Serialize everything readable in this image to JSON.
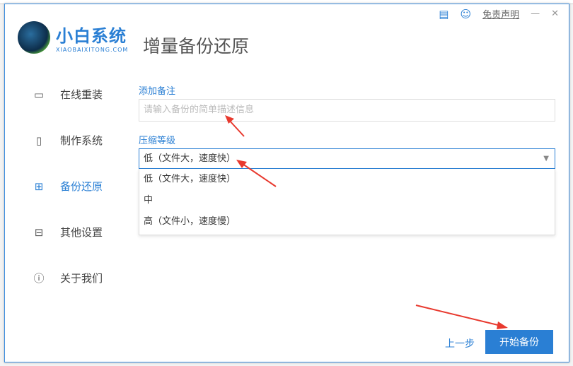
{
  "header": {
    "logo_title": "小白系统",
    "logo_sub": "XIAOBAIXITONG.COM",
    "page_title": "增量备份还原",
    "disclaimer": "免责声明",
    "minimize": "—",
    "close": "✕"
  },
  "nav": [
    {
      "label": "在线重装",
      "icon": "▭"
    },
    {
      "label": "制作系统",
      "icon": "▯"
    },
    {
      "label": "备份还原",
      "icon": "⊞"
    },
    {
      "label": "其他设置",
      "icon": "⊟"
    },
    {
      "label": "关于我们",
      "icon": "ⓘ"
    }
  ],
  "form": {
    "note_label": "添加备注",
    "note_placeholder": "请输入备份的简单描述信息",
    "note_value": "",
    "compress_label": "压缩等级",
    "compress_value": "低（文件大，速度快）",
    "options": [
      "低（文件大，速度快）",
      "中",
      "高（文件小，速度慢）"
    ]
  },
  "footer": {
    "prev": "上一步",
    "start": "开始备份"
  },
  "colors": {
    "accent": "#2a7fd4",
    "arrow": "#e8392e"
  }
}
